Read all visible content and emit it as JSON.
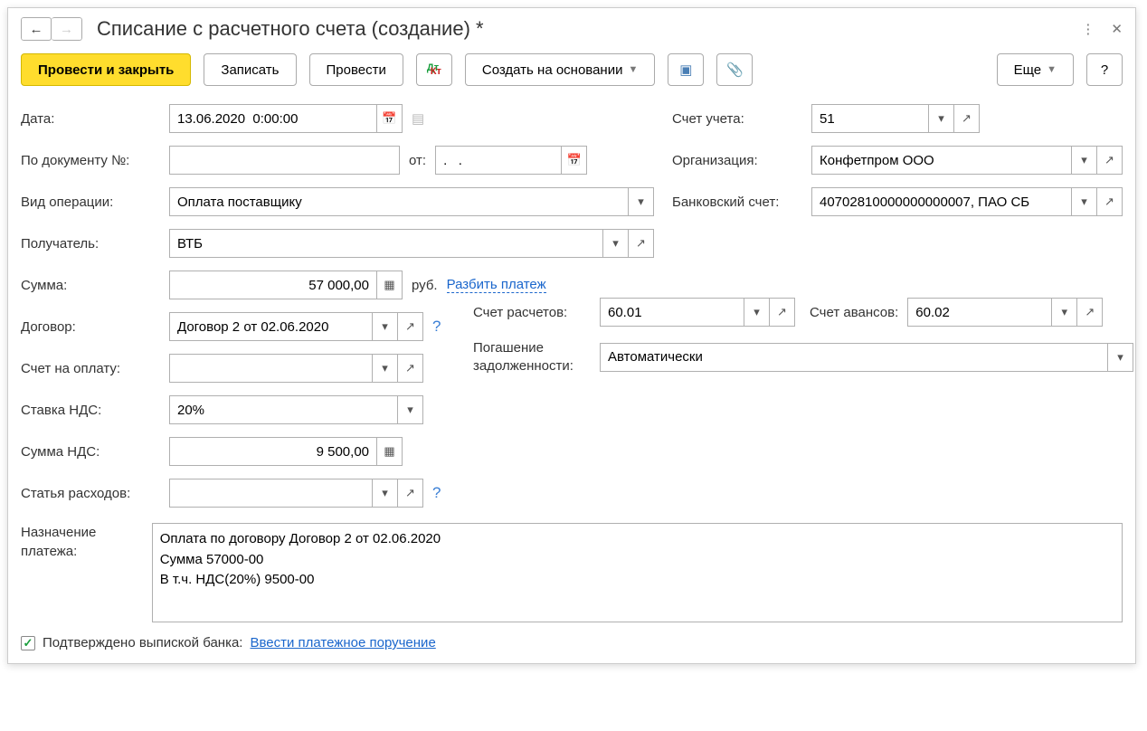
{
  "title": "Списание с расчетного счета (создание) *",
  "toolbar": {
    "post_close": "Провести и закрыть",
    "save": "Записать",
    "post": "Провести",
    "create_based": "Создать на основании",
    "more": "Еще",
    "help": "?"
  },
  "labels": {
    "date": "Дата:",
    "doc_no": "По документу №:",
    "from": "от:",
    "op_type": "Вид операции:",
    "recipient": "Получатель:",
    "amount": "Сумма:",
    "currency": "руб.",
    "split_payment": "Разбить платеж",
    "contract": "Договор:",
    "settlement_account": "Счет расчетов:",
    "advance_account": "Счет авансов:",
    "invoice": "Счет на оплату:",
    "debt_repayment": "Погашение задолженности:",
    "vat_rate": "Ставка НДС:",
    "vat_amount": "Сумма НДС:",
    "expense_item": "Статья расходов:",
    "purpose": "Назначение платежа:",
    "account": "Счет учета:",
    "organization": "Организация:",
    "bank_account": "Банковский счет:",
    "confirmed": "Подтверждено выпиской банка:",
    "enter_payment_order": "Ввести платежное поручение"
  },
  "values": {
    "date": "13.06.2020  0:00:00",
    "doc_no": "",
    "from": ".   .",
    "op_type": "Оплата поставщику",
    "recipient": "ВТБ",
    "amount": "57 000,00",
    "contract": "Договор 2 от 02.06.2020",
    "settlement_account": "60.01",
    "advance_account": "60.02",
    "invoice": "",
    "debt_repayment": "Автоматически",
    "vat_rate": "20%",
    "vat_amount": "9 500,00",
    "expense_item": "",
    "purpose": "Оплата по договору Договор 2 от 02.06.2020\nСумма 57000-00\nВ т.ч. НДС(20%) 9500-00",
    "account": "51",
    "organization": "Конфетпром ООО",
    "bank_account": "40702810000000000007, ПАО СБ"
  }
}
